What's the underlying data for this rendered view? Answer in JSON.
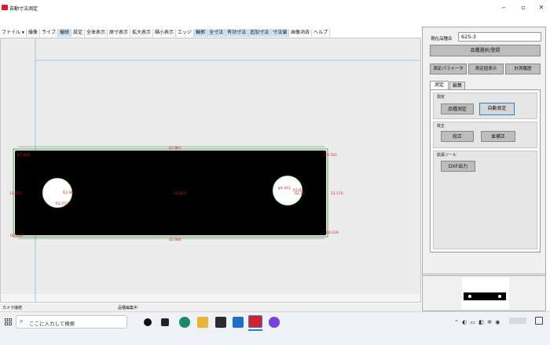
{
  "window": {
    "title": "自動寸法測定",
    "minimize": "‒",
    "maximize": "▫",
    "close": "✕"
  },
  "menu": [
    {
      "label": "ファイル ▾",
      "active": false
    },
    {
      "label": "撮像",
      "active": false
    },
    {
      "label": "ライブ",
      "active": false
    },
    {
      "label": "撮続",
      "active": true
    },
    {
      "label": "設定",
      "active": false
    },
    {
      "label": "全体表示",
      "active": false
    },
    {
      "label": "原寸表示",
      "active": false
    },
    {
      "label": "拡大表示",
      "active": false
    },
    {
      "label": "縮小表示",
      "active": false
    },
    {
      "label": "エッジ",
      "active": false
    },
    {
      "label": "輪郭",
      "active": true
    },
    {
      "label": "全寸法",
      "active": true
    },
    {
      "label": "有効寸法",
      "active": true
    },
    {
      "label": "追加寸法",
      "active": true
    },
    {
      "label": "寸法値",
      "active": true
    },
    {
      "label": "画像消去",
      "active": false
    },
    {
      "label": "ヘルプ",
      "active": false
    }
  ],
  "measurement": {
    "top_width": "42.961",
    "bottom_width": "42.960",
    "left_height": "11.157",
    "right_height": "11.170",
    "center_height": "11.821",
    "left_hole": {
      "upper": "R2.96",
      "lower": "R2.232"
    },
    "right_hole": {
      "left": "φ4.441",
      "upper": "R2.81",
      "lower": "R2.21"
    },
    "corners": {
      "tl": "R7.001",
      "tr": "R0.502",
      "bl": "R0.224",
      "br": "R0.226"
    }
  },
  "status": {
    "camera": "カメラ接続",
    "mode": "品種編集中"
  },
  "panel": {
    "product_name_label": "現在品種名",
    "product_name_value": "625-3",
    "select_register_button": "品種選択/登録",
    "param_button": "測定パラメータ",
    "value_display_button": "測定値表示",
    "history_button": "計測履歴",
    "tabs": [
      "測定",
      "編集"
    ],
    "measure_group": "測定",
    "product_measure_button": "品種測定",
    "auto_measure_button": "自動測定",
    "calibration_group": "校正",
    "calibrate_button": "校正",
    "auto_calibrate_button": "並補正",
    "ext_tools_group": "拡張ツール",
    "dxf_button": "DXF出力"
  },
  "taskbar": {
    "search_placeholder": "ここに入力して検索"
  },
  "colors": {
    "annotation": "#e21b1b",
    "contour": "#2a8a2a",
    "guide": "#6aa6d8",
    "accent": "#2b7cd3"
  }
}
